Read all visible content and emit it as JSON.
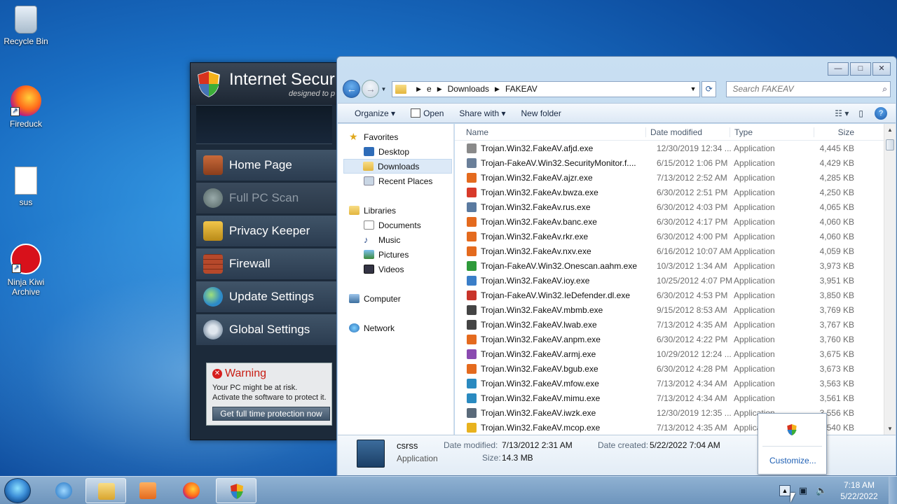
{
  "desktop": {
    "icons": [
      {
        "label": "Recycle Bin",
        "icon": "recycle-bin-icon"
      },
      {
        "label": "Fireduck",
        "icon": "browser-icon"
      },
      {
        "label": "sus",
        "icon": "document-icon"
      },
      {
        "label": "Ninja Kiwi Archive",
        "label_line1": "Ninja Kiwi",
        "label_line2": "Archive",
        "icon": "ninja-kiwi-icon"
      }
    ]
  },
  "av_window": {
    "title": "Internet Secur",
    "subtitle": "designed to p",
    "menu": [
      {
        "label": "Home Page",
        "icon": "house-icon",
        "enabled": true
      },
      {
        "label": "Full PC Scan",
        "icon": "magnifier-icon",
        "enabled": false
      },
      {
        "label": "Privacy Keeper",
        "icon": "padlock-icon",
        "enabled": true
      },
      {
        "label": "Firewall",
        "icon": "brick-wall-icon",
        "enabled": true
      },
      {
        "label": "Update Settings",
        "icon": "globe-icon",
        "enabled": true
      },
      {
        "label": "Global Settings",
        "icon": "gear-icon",
        "enabled": true
      }
    ],
    "warning": {
      "title": "Warning",
      "line1": "Your PC might be at risk.",
      "line2": "Activate the software to protect it.",
      "button": "Get full time protection now"
    }
  },
  "explorer": {
    "caption_buttons": {
      "minimize": "—",
      "maximize": "□",
      "close": "✕"
    },
    "nav": {
      "back": "←",
      "forward": "→"
    },
    "breadcrumb": [
      "e",
      "Downloads",
      "FAKEAV"
    ],
    "search_placeholder": "Search FAKEAV",
    "toolbar": {
      "organize": "Organize",
      "open": "Open",
      "share_with": "Share with",
      "new_folder": "New folder"
    },
    "nav_pane": {
      "favorites": "Favorites",
      "favorites_items": [
        "Desktop",
        "Downloads",
        "Recent Places"
      ],
      "selected": "Downloads",
      "libraries": "Libraries",
      "libraries_items": [
        "Documents",
        "Music",
        "Pictures",
        "Videos"
      ],
      "computer": "Computer",
      "network": "Network"
    },
    "columns": {
      "name": "Name",
      "date": "Date modified",
      "type": "Type",
      "size": "Size"
    },
    "files": [
      {
        "name": "Trojan.Win32.FakeAV.afjd.exe",
        "date": "12/30/2019 12:34 ...",
        "type": "Application",
        "size": "4,445 KB",
        "color": "#8a8a8a"
      },
      {
        "name": "Trojan-FakeAV.Win32.SecurityMonitor.f....",
        "date": "6/15/2012 1:06 PM",
        "type": "Application",
        "size": "4,429 KB",
        "color": "#6a7f99"
      },
      {
        "name": "Trojan.Win32.FakeAV.ajzr.exe",
        "date": "7/13/2012 2:52 AM",
        "type": "Application",
        "size": "4,285 KB",
        "color": "#e46a1e"
      },
      {
        "name": "Trojan.Win32.FakeAv.bwza.exe",
        "date": "6/30/2012 2:51 PM",
        "type": "Application",
        "size": "4,250 KB",
        "color": "#d83a2a"
      },
      {
        "name": "Trojan.Win32.FakeAv.rus.exe",
        "date": "6/30/2012 4:03 PM",
        "type": "Application",
        "size": "4,065 KB",
        "color": "#5a7aa0"
      },
      {
        "name": "Trojan.Win32.FakeAv.banc.exe",
        "date": "6/30/2012 4:17 PM",
        "type": "Application",
        "size": "4,060 KB",
        "color": "#e46a1e"
      },
      {
        "name": "Trojan.Win32.FakeAv.rkr.exe",
        "date": "6/30/2012 4:00 PM",
        "type": "Application",
        "size": "4,060 KB",
        "color": "#e46a1e"
      },
      {
        "name": "Trojan.Win32.FakeAv.nxv.exe",
        "date": "6/16/2012 10:07 AM",
        "type": "Application",
        "size": "4,059 KB",
        "color": "#e46a1e"
      },
      {
        "name": "Trojan-FakeAV.Win32.Onescan.aahm.exe",
        "date": "10/3/2012 1:34 AM",
        "type": "Application",
        "size": "3,973 KB",
        "color": "#2e9a3a"
      },
      {
        "name": "Trojan.Win32.FakeAV.ioy.exe",
        "date": "10/25/2012 4:07 PM",
        "type": "Application",
        "size": "3,951 KB",
        "color": "#3a7ec8"
      },
      {
        "name": "Trojan-FakeAV.Win32.IeDefender.dl.exe",
        "date": "6/30/2012 4:53 PM",
        "type": "Application",
        "size": "3,850 KB",
        "color": "#c8342a"
      },
      {
        "name": "Trojan.Win32.FakeAV.mbmb.exe",
        "date": "9/15/2012 8:53 AM",
        "type": "Application",
        "size": "3,769 KB",
        "color": "#444444"
      },
      {
        "name": "Trojan.Win32.FakeAV.lwab.exe",
        "date": "7/13/2012 4:35 AM",
        "type": "Application",
        "size": "3,767 KB",
        "color": "#444444"
      },
      {
        "name": "Trojan.Win32.FakeAV.anpm.exe",
        "date": "6/30/2012 4:22 PM",
        "type": "Application",
        "size": "3,760 KB",
        "color": "#e46a1e"
      },
      {
        "name": "Trojan.Win32.FakeAV.armj.exe",
        "date": "10/29/2012 12:24 ...",
        "type": "Application",
        "size": "3,675 KB",
        "color": "#8a4ab0"
      },
      {
        "name": "Trojan.Win32.FakeAV.bgub.exe",
        "date": "6/30/2012 4:28 PM",
        "type": "Application",
        "size": "3,673 KB",
        "color": "#e46a1e"
      },
      {
        "name": "Trojan.Win32.FakeAV.mfow.exe",
        "date": "7/13/2012 4:34 AM",
        "type": "Application",
        "size": "3,563 KB",
        "color": "#2a8ac0"
      },
      {
        "name": "Trojan.Win32.FakeAV.mimu.exe",
        "date": "7/13/2012 4:34 AM",
        "type": "Application",
        "size": "3,561 KB",
        "color": "#2a8ac0"
      },
      {
        "name": "Trojan.Win32.FakeAV.iwzk.exe",
        "date": "12/30/2019 12:35 ...",
        "type": "Application",
        "size": "3,556 KB",
        "color": "#5a6a7a"
      },
      {
        "name": "Trojan.Win32.FakeAV.mcop.exe",
        "date": "7/13/2012 4:35 AM",
        "type": "Application",
        "size": "3,540 KB",
        "color": "#e8b21e"
      }
    ],
    "details": {
      "name": "csrss",
      "type": "Application",
      "date_modified_label": "Date modified:",
      "date_modified": "7/13/2012 2:31 AM",
      "date_created_label": "Date created:",
      "date_created": "5/22/2022 7:04 AM",
      "size_label": "Size:",
      "size": "14.3 MB"
    }
  },
  "tray_popup": {
    "customize": "Customize..."
  },
  "taskbar": {
    "apps": [
      "internet-explorer-icon",
      "file-explorer-icon",
      "media-player-icon",
      "firefox-icon",
      "security-shield-icon"
    ],
    "time": "7:18 AM",
    "date": "5/22/2022"
  }
}
